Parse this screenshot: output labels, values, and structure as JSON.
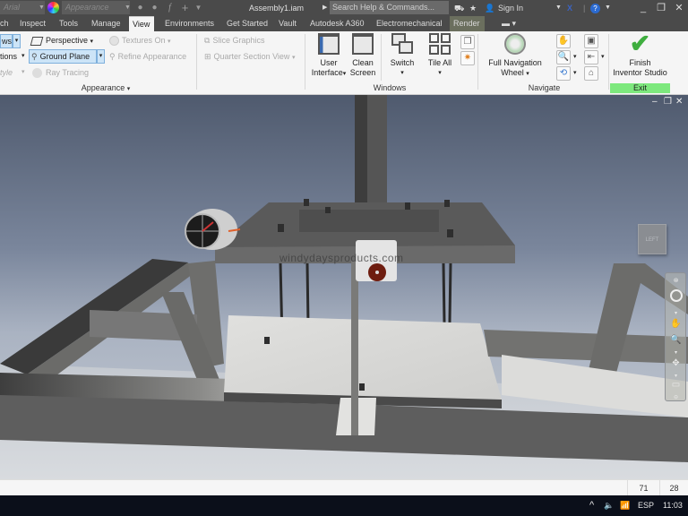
{
  "titlebar": {
    "font_field": "Arial",
    "appearance_field": "Appearance",
    "document_title": "Assembly1.iam",
    "search_placeholder": "Search Help & Commands...",
    "sign_in": "Sign In",
    "icons": [
      "color-wheel-icon",
      "material-icon",
      "clear-override-icon",
      "fx-icon",
      "plus-icon",
      "customize-qat-icon",
      "arrow-icon",
      "exchange-apps-icon",
      "star-icon",
      "user-icon",
      "autodesk-x-icon",
      "help-icon"
    ]
  },
  "tabs": [
    {
      "label": "ch"
    },
    {
      "label": "Inspect"
    },
    {
      "label": "Tools"
    },
    {
      "label": "Manage"
    },
    {
      "label": "View",
      "active": true
    },
    {
      "label": "Environments"
    },
    {
      "label": "Get Started"
    },
    {
      "label": "Vault"
    },
    {
      "label": "Autodesk A360"
    },
    {
      "label": "Electromechanical"
    },
    {
      "label": "Render"
    }
  ],
  "ribbon": {
    "appearance": {
      "label": "Appearance",
      "items": {
        "shadows": "ws",
        "reflections": "tions",
        "visual_style": "tyle",
        "perspective": "Perspective",
        "ground_plane": "Ground Plane",
        "ray_tracing": "Ray Tracing",
        "textures_on": "Textures On",
        "refine_appearance": "Refine Appearance",
        "slice_graphics": "Slice Graphics",
        "quarter_section_view": "Quarter Section View"
      }
    },
    "windows": {
      "label": "Windows",
      "user_interface_1": "User",
      "user_interface_2": "Interface",
      "clean_screen_1": "Clean",
      "clean_screen_2": "Screen",
      "switch": "Switch",
      "tile_all": "Tile All"
    },
    "navigate": {
      "label": "Navigate",
      "full_nav_wheel_1": "Full Navigation",
      "full_nav_wheel_2": "Wheel"
    },
    "exit": {
      "label": "Exit",
      "finish_1": "Finish",
      "finish_2": "Inventor Studio",
      "accent": "#7de87d"
    }
  },
  "viewport": {
    "viewcube_face": "LEFT",
    "watermark": "windydaysproducts.com"
  },
  "statusbar": {
    "value1": "71",
    "value2": "28"
  },
  "taskbar": {
    "language": "ESP",
    "time": "11:03"
  }
}
